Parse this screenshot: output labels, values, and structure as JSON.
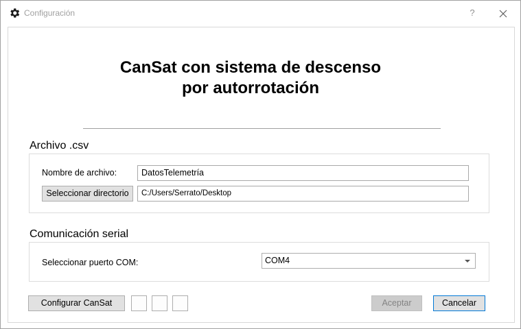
{
  "window": {
    "title": "Configuración",
    "help_label": "?",
    "icons": {
      "app": "gear-icon",
      "close": "close-icon"
    }
  },
  "main": {
    "title_line1": "CanSat con sistema de descenso",
    "title_line2": "por autorrotación"
  },
  "csv_group": {
    "title": "Archivo .csv",
    "filename_label": "Nombre de archivo:",
    "filename_value": "DatosTelemetría",
    "select_dir_button": "Seleccionar directorio",
    "directory_value": "C:/Users/Serrato/Desktop"
  },
  "serial_group": {
    "title": "Comunicación serial",
    "port_label": "Seleccionar puerto COM:",
    "port_value": "COM4"
  },
  "footer": {
    "configure_button": "Configurar CanSat",
    "accept_button": "Aceptar",
    "cancel_button": "Cancelar"
  },
  "colors": {
    "focus_border": "#0078d7",
    "disabled_text": "#838383"
  }
}
